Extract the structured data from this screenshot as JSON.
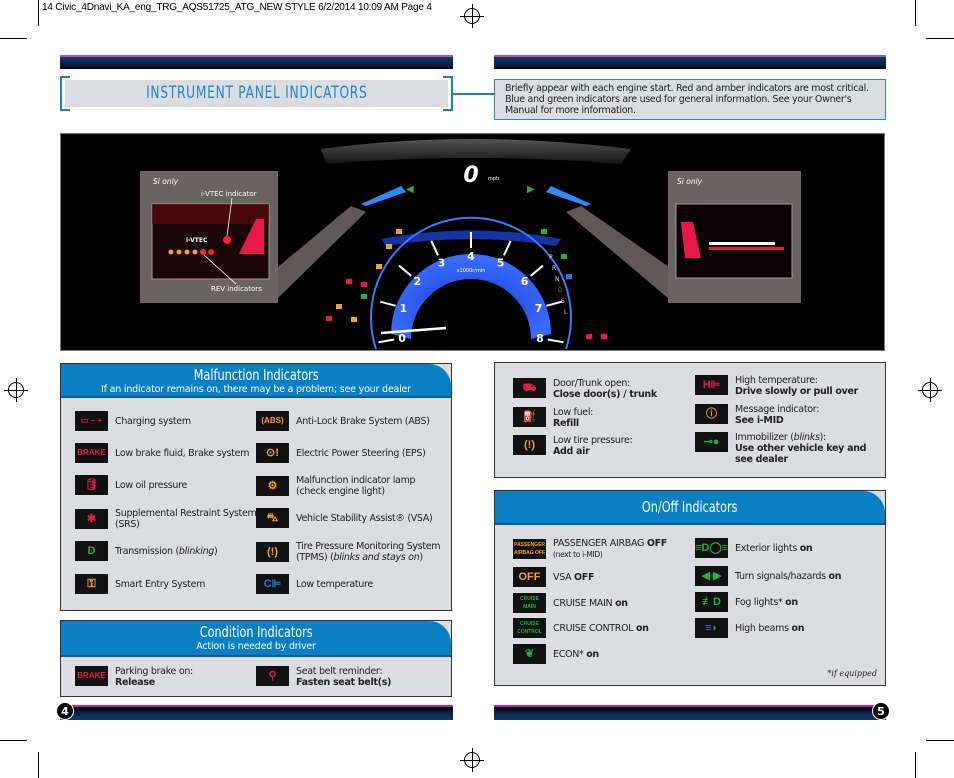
{
  "slug": "14 Civic_4Dnavi_KA_eng_TRG_AQS51725_ATG_NEW STYLE  6/2/2014  10:09 AM  Page 4",
  "title": "INSTRUMENT PANEL INDICATORS",
  "intro": "Briefly appear with each engine start. Red and amber indicators are most critical. Blue and green indicators are used for general information. See your Owner's Manual for more information.",
  "dashboard": {
    "left_callout": {
      "tag": "Si only",
      "vtec": "i-VTEC indicator",
      "rev": "REV indicators",
      "badge": "i-VTEC"
    },
    "right_callout": {
      "tag": "Si only"
    },
    "speed": "0",
    "speed_unit": "mph",
    "tach_unit": "x1000r/min",
    "tach_numbers": [
      "0",
      "1",
      "2",
      "3",
      "4",
      "5",
      "6",
      "7",
      "8"
    ],
    "gear_letters": [
      "P",
      "R",
      "N",
      "D",
      "S",
      "L"
    ]
  },
  "malfunction": {
    "title": "Malfunction Indicators",
    "subtitle": "If an indicator remains on, there may be a problem; see your dealer",
    "left": [
      {
        "icon": "battery-icon",
        "glyph": "▭ − +",
        "color": "#e8194a",
        "text": "Charging system"
      },
      {
        "icon": "brake-icon",
        "glyph": "BRAKE",
        "color": "#e8194a",
        "text": "Low brake fluid, Brake system"
      },
      {
        "icon": "oil-can-icon",
        "glyph": "🛢",
        "color": "#e8194a",
        "text": "Low oil pressure"
      },
      {
        "icon": "airbag-icon",
        "glyph": "✱",
        "color": "#e8194a",
        "text": "Supplemental Restraint System (SRS)"
      },
      {
        "icon": "transmission-d-icon",
        "glyph": "D",
        "color": "#1db24a",
        "text": "Transmission (",
        "em": "blinking",
        ")": ")"
      },
      {
        "icon": "smart-entry-icon",
        "glyph": "⚿",
        "color": "#f5a31a",
        "text": "Smart Entry System"
      }
    ],
    "right": [
      {
        "icon": "abs-icon",
        "glyph": "(ABS)",
        "color": "#f5a31a",
        "text": "Anti-Lock Brake System (ABS)"
      },
      {
        "icon": "eps-icon",
        "glyph": "⊙!",
        "color": "#f5a31a",
        "text": "Electric Power Steering (EPS)"
      },
      {
        "icon": "check-engine-icon",
        "glyph": "⚙",
        "color": "#f5a31a",
        "text": "Malfunction indicator lamp (check engine light)"
      },
      {
        "icon": "vsa-icon",
        "glyph": "⛍",
        "color": "#f5a31a",
        "text": "Vehicle Stability Assist® (VSA)"
      },
      {
        "icon": "tpms-icon",
        "glyph": "(!)",
        "color": "#f5a31a",
        "text": "Tire Pressure Monitoring System (TPMS) (",
        "em": "blinks and stays on",
        ")": ")"
      },
      {
        "icon": "low-temperature-icon",
        "glyph": "C⊫",
        "color": "#1a7fe0",
        "text": "Low temperature"
      }
    ]
  },
  "condition": {
    "title": "Condition Indicators",
    "subtitle": "Action is needed by driver",
    "items": [
      {
        "icon": "parking-brake-icon",
        "glyph": "BRAKE",
        "color": "#e8194a",
        "line1": "Parking brake on:",
        "line2": "Release"
      },
      {
        "icon": "seat-belt-icon",
        "glyph": "⚲",
        "color": "#e8194a",
        "line1": "Seat belt reminder:",
        "line2": "Fasten seat belt(s)"
      }
    ]
  },
  "alerts": {
    "left": [
      {
        "icon": "door-open-icon",
        "glyph": "⛟",
        "color": "#e8194a",
        "line1": "Door/Trunk open:",
        "line2": "Close door(s) / trunk"
      },
      {
        "icon": "fuel-icon",
        "glyph": "⛽",
        "color": "#f5a31a",
        "line1": "Low fuel:",
        "line2": "Refill"
      },
      {
        "icon": "low-tire-icon",
        "glyph": "(!)",
        "color": "#f5a31a",
        "line1": "Low tire pressure:",
        "line2": "Add air"
      }
    ],
    "right": [
      {
        "icon": "high-temperature-icon",
        "glyph": "H⊫",
        "color": "#e8194a",
        "line1": "High temperature:",
        "line2": "Drive slowly or pull over"
      },
      {
        "icon": "message-icon",
        "glyph": "ⓘ",
        "color": "#f5a31a",
        "line1": "Message indicator:",
        "line2": "See i-MID"
      },
      {
        "icon": "immobilizer-key-icon",
        "glyph": "⊸●",
        "color": "#1db24a",
        "line1": "Immobilizer (",
        "em": "blinks",
        "line1b": "):",
        "line2": "Use other vehicle key and see dealer"
      }
    ]
  },
  "onoff": {
    "title": "On/Off Indicators",
    "left": [
      {
        "icon": "passenger-airbag-off-icon",
        "glyph": "PASSENGER AIRBAG OFF",
        "color": "#f5a31a",
        "text": "PASSENGER AIRBAG ",
        "bold": "OFF",
        "note": "(next to i-MID)"
      },
      {
        "icon": "vsa-off-icon",
        "glyph": "OFF",
        "color": "#f5a31a",
        "text": "VSA ",
        "bold": "OFF"
      },
      {
        "icon": "cruise-main-icon",
        "glyph": "CRUISE MAIN",
        "color": "#1db24a",
        "text": "CRUISE MAIN ",
        "bold": "on"
      },
      {
        "icon": "cruise-control-icon",
        "glyph": "CRUISE CONTROL",
        "color": "#1db24a",
        "text": "CRUISE CONTROL ",
        "bold": "on"
      },
      {
        "icon": "econ-icon",
        "glyph": "❦",
        "color": "#1db24a",
        "text": "ECON* ",
        "bold": "on"
      }
    ],
    "right": [
      {
        "icon": "exterior-lights-icon",
        "glyph": "≡D◯≡",
        "color": "#1db24a",
        "text": "Exterior lights ",
        "bold": "on"
      },
      {
        "icon": "turn-signal-icon",
        "glyph": "◀ ▶",
        "color": "#1db24a",
        "text": "Turn signals/hazards ",
        "bold": "on"
      },
      {
        "icon": "fog-lights-icon",
        "glyph": "≢D",
        "color": "#1db24a",
        "text": "Fog lights* ",
        "bold": "on"
      },
      {
        "icon": "high-beams-icon",
        "glyph": "≡◗",
        "color": "#1a7fe0",
        "text": "High beams ",
        "bold": "on"
      }
    ],
    "footnote": "*if equipped"
  },
  "pages": {
    "left": "4",
    "right": "5"
  }
}
